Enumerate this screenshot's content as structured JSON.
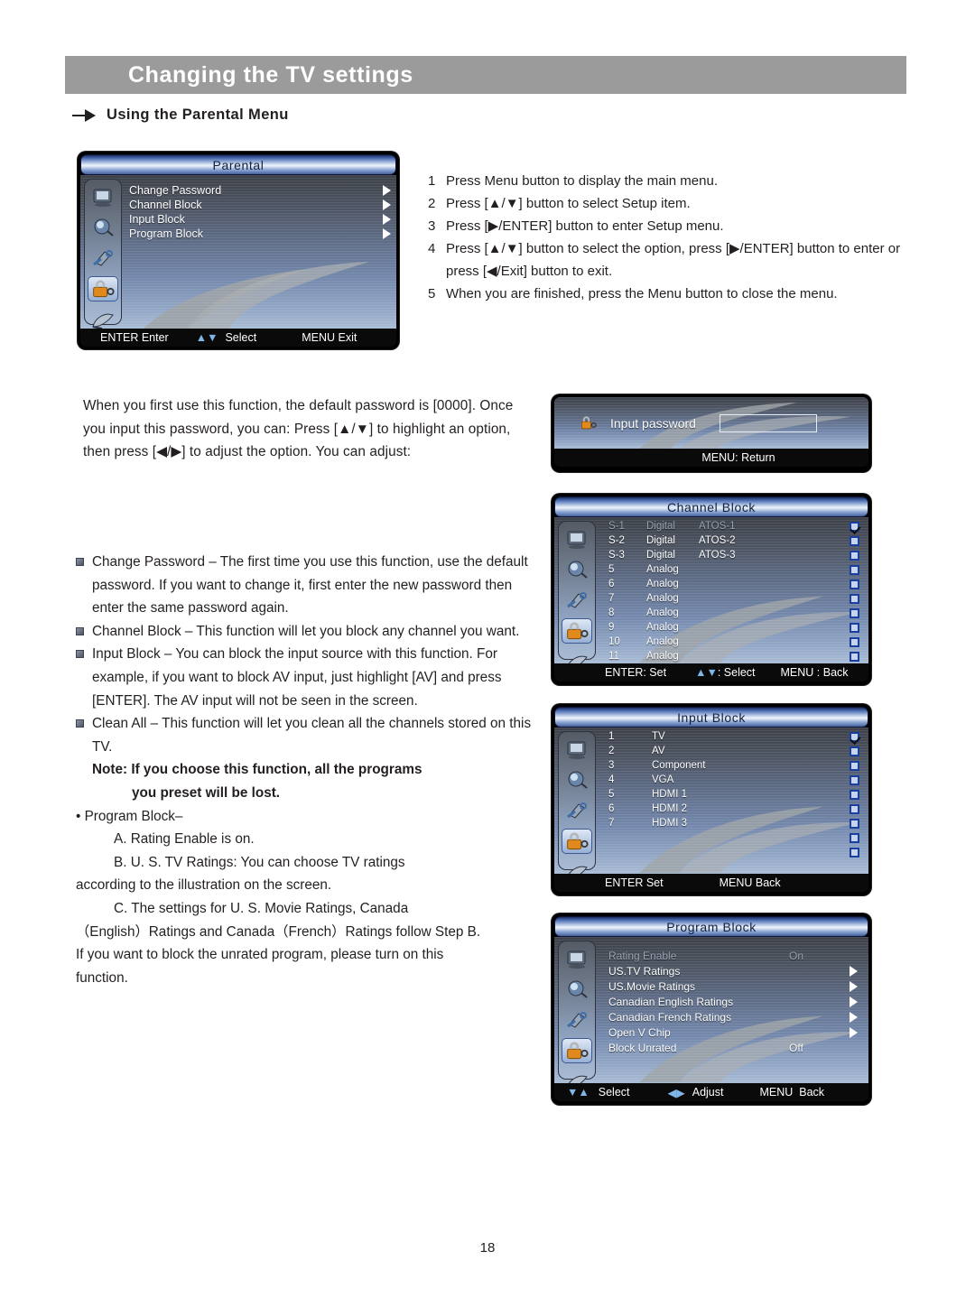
{
  "header": {
    "title": "Changing the TV settings"
  },
  "section": {
    "title": "Using the Parental Menu",
    "bullet_icon": "arrow-right-icon"
  },
  "parental_osd": {
    "title": "Parental",
    "items": [
      {
        "label": "Change Password",
        "marker": "chevron-right-icon"
      },
      {
        "label": "Channel Block",
        "marker": "chevron-right-icon"
      },
      {
        "label": "Input Block",
        "marker": "chevron-right-icon"
      },
      {
        "label": "Program Block",
        "marker": "chevron-right-icon"
      }
    ],
    "footer": {
      "enter": "ENTER Enter",
      "select": "Select",
      "exit": "MENU Exit",
      "updown_icon": "up-down-arrows-icon"
    },
    "sidebar_icons": [
      "picture-icon",
      "sound-icon",
      "setup-tools-icon",
      "lock-icon",
      "satellite-dish-icon"
    ],
    "selected_sidebar_index": 3
  },
  "steps": [
    {
      "num": "1",
      "text": "Press Menu button to display the main menu."
    },
    {
      "num": "2",
      "text": "Press [▲/▼] button to select Setup item."
    },
    {
      "num": "3",
      "text": "Press [▶/ENTER] button to enter Setup menu."
    },
    {
      "num": "4",
      "text": "Press [▲/▼] button to select the option, press [▶/ENTER] button to enter or press [◀/Exit] button to exit."
    },
    {
      "num": "5",
      "text": "When you are finished, press the Menu button to close the menu."
    }
  ],
  "intro_paragraph": "When you first use this function, the default password is [0000]. Once you input this password, you can: Press [▲/▼] to highlight an option, then press [◀/▶] to adjust the option. You can adjust:",
  "bullets": [
    {
      "text": "Change Password – The first time you use this function, use the default password. If you want to change it, first enter the new password then enter the same password again."
    },
    {
      "text": "Channel Block – This function will let you block any channel you want."
    },
    {
      "text": "Input Block – You can block the input source with this function. For example, if you want to block AV input, just highlight [AV] and press [ENTER]. The AV input will not be seen in the screen."
    },
    {
      "text": "Clean All – This function will let you clean all the channels stored on this TV."
    }
  ],
  "note": {
    "line1": "Note: If you choose this function, all the programs",
    "line2": "you preset will be lost."
  },
  "program_block_text": {
    "heading": "• Program Block–",
    "a": "A. Rating Enable is on.",
    "b": "B. U. S. TV Ratings: You can choose TV ratings",
    "b_cont": "according to the illustration on the screen.",
    "c": "C. The settings for U. S. Movie Ratings, Canada",
    "c_cont1": "（English）Ratings and Canada（French）Ratings follow Step B.",
    "c_cont2": "If you want to block the unrated program, please turn on this",
    "c_cont3": "function."
  },
  "password_osd": {
    "icon": "lock-icon",
    "label": "Input password",
    "field_value": "",
    "footer": "MENU: Return"
  },
  "channel_block_osd": {
    "title": "Channel Block",
    "columns": [
      "channel",
      "type",
      "name",
      "blocked"
    ],
    "rows": [
      {
        "channel": "S-1",
        "type": "Digital",
        "name": "ATOS-1",
        "checked": true,
        "dim": true
      },
      {
        "channel": "S-2",
        "type": "Digital",
        "name": "ATOS-2",
        "checked": false,
        "dim": false
      },
      {
        "channel": "S-3",
        "type": "Digital",
        "name": "ATOS-3",
        "checked": false,
        "dim": false
      },
      {
        "channel": "5",
        "type": "Analog",
        "name": "",
        "checked": false,
        "dim": false
      },
      {
        "channel": "6",
        "type": "Analog",
        "name": "",
        "checked": false,
        "dim": false
      },
      {
        "channel": "7",
        "type": "Analog",
        "name": "",
        "checked": false,
        "dim": false
      },
      {
        "channel": "8",
        "type": "Analog",
        "name": "",
        "checked": false,
        "dim": false
      },
      {
        "channel": "9",
        "type": "Analog",
        "name": "",
        "checked": false,
        "dim": false
      },
      {
        "channel": "10",
        "type": "Analog",
        "name": "",
        "checked": false,
        "dim": false
      },
      {
        "channel": "11",
        "type": "Analog",
        "name": "",
        "checked": false,
        "dim": false
      }
    ],
    "footer": {
      "set": "ENTER: Set",
      "select": ": Select",
      "back": "MENU : Back"
    }
  },
  "input_block_osd": {
    "title": "Input Block",
    "rows": [
      {
        "num": "1",
        "label": "TV",
        "checked": true
      },
      {
        "num": "2",
        "label": "AV",
        "checked": false
      },
      {
        "num": "3",
        "label": "Component",
        "checked": false
      },
      {
        "num": "4",
        "label": "VGA",
        "checked": false
      },
      {
        "num": "5",
        "label": "HDMI 1",
        "checked": false
      },
      {
        "num": "6",
        "label": "HDMI 2",
        "checked": false
      },
      {
        "num": "7",
        "label": "HDMI 3",
        "checked": false
      },
      {
        "num": "",
        "label": "",
        "checked": false
      },
      {
        "num": "",
        "label": "",
        "checked": false
      }
    ],
    "footer": {
      "set": "ENTER Set",
      "back": "MENU Back"
    }
  },
  "program_block_osd": {
    "title": "Program Block",
    "rows": [
      {
        "label": "Rating Enable",
        "value": "On",
        "arrow": false,
        "dim": true
      },
      {
        "label": "US.TV Ratings",
        "value": "",
        "arrow": true,
        "dim": false
      },
      {
        "label": "US.Movie Ratings",
        "value": "",
        "arrow": true,
        "dim": false
      },
      {
        "label": "Canadian English Ratings",
        "value": "",
        "arrow": true,
        "dim": false
      },
      {
        "label": "Canadian French Ratings",
        "value": "",
        "arrow": true,
        "dim": false
      },
      {
        "label": "Open V Chip",
        "value": "",
        "arrow": true,
        "dim": false
      },
      {
        "label": "Block Unrated",
        "value": "Off",
        "arrow": false,
        "dim": false
      }
    ],
    "footer": {
      "select": "Select",
      "adjust": "Adjust",
      "back": "MENU  Back"
    }
  },
  "page_number": "18",
  "colors": {
    "header_bar": "#9b9b9b",
    "text": "#231f20",
    "osd_title_blue": "#1c2e63",
    "osd_check_blue": "#1b3fa0",
    "lock_orange": "#e08a1e"
  }
}
